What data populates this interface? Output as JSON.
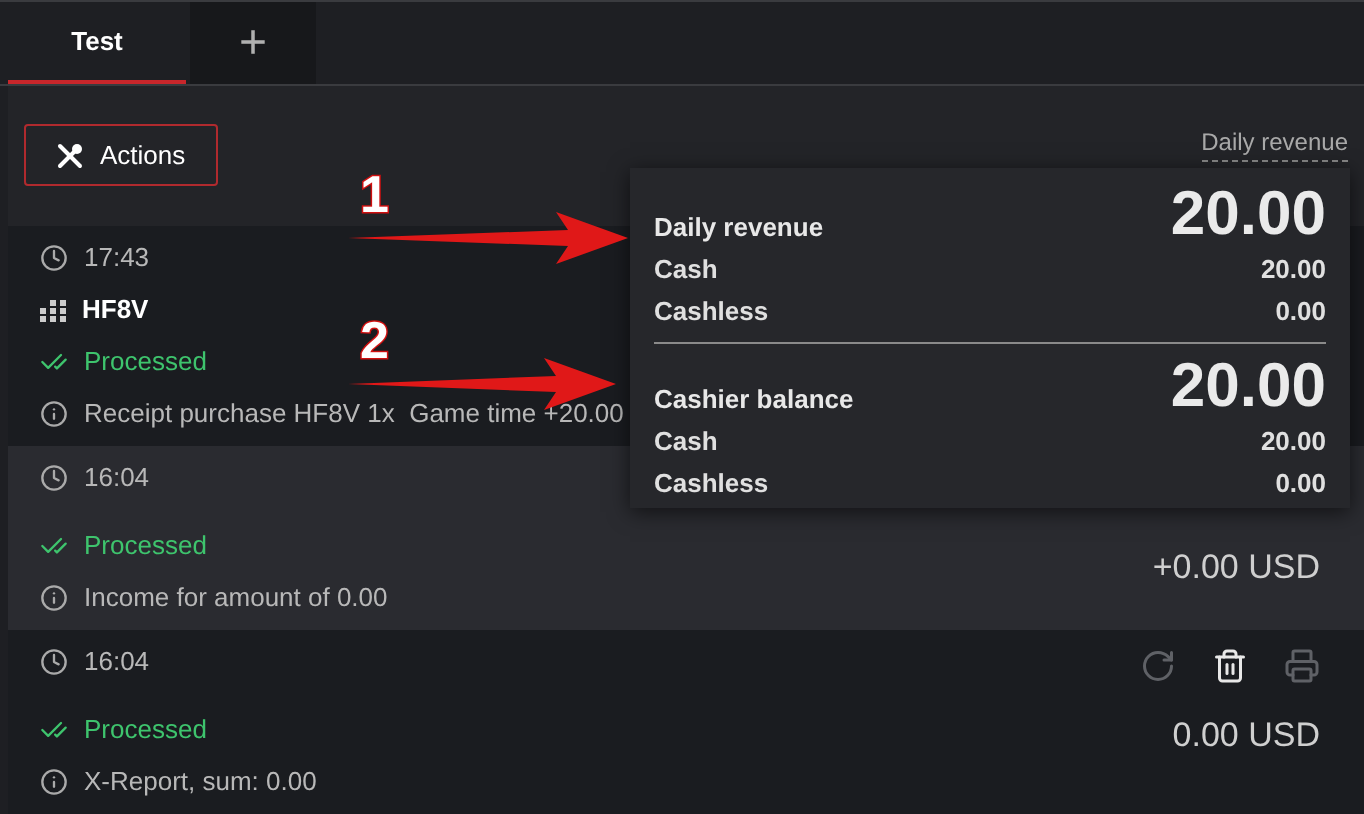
{
  "tabs": [
    {
      "label": "Test",
      "kind": "tab",
      "selected": true
    },
    {
      "label": "+",
      "kind": "add",
      "selected": false
    }
  ],
  "toolbar": {
    "actions_button": "Actions",
    "summary_link": "Daily revenue"
  },
  "rows": [
    {
      "time": "17:43",
      "code": "HF8V",
      "status": "Processed",
      "description": "Receipt purchase HF8V 1x  Game time +20.00",
      "highlighted": false
    },
    {
      "time": "16:04",
      "status": "Processed",
      "description": "Income for amount of 0.00",
      "amount": "+0.00 USD",
      "highlighted": true
    },
    {
      "time": "16:04",
      "status": "Processed",
      "description": "X-Report, sum: 0.00",
      "amount": "0.00 USD",
      "highlighted": false,
      "actions": [
        {
          "kind": "refresh",
          "disabled": true
        },
        {
          "kind": "delete",
          "disabled": false
        },
        {
          "kind": "print",
          "disabled": true
        }
      ]
    }
  ],
  "popover": {
    "sections": [
      {
        "title": "Daily revenue",
        "total": "20.00",
        "lines": [
          {
            "label": "Cash",
            "value": "20.00"
          },
          {
            "label": "Cashless",
            "value": "0.00"
          }
        ]
      },
      {
        "title": "Cashier balance",
        "total": "20.00",
        "lines": [
          {
            "label": "Cash",
            "value": "20.00"
          },
          {
            "label": "Cashless",
            "value": "0.00"
          }
        ]
      }
    ]
  },
  "annotations": [
    {
      "label": "1"
    },
    {
      "label": "2"
    }
  ]
}
